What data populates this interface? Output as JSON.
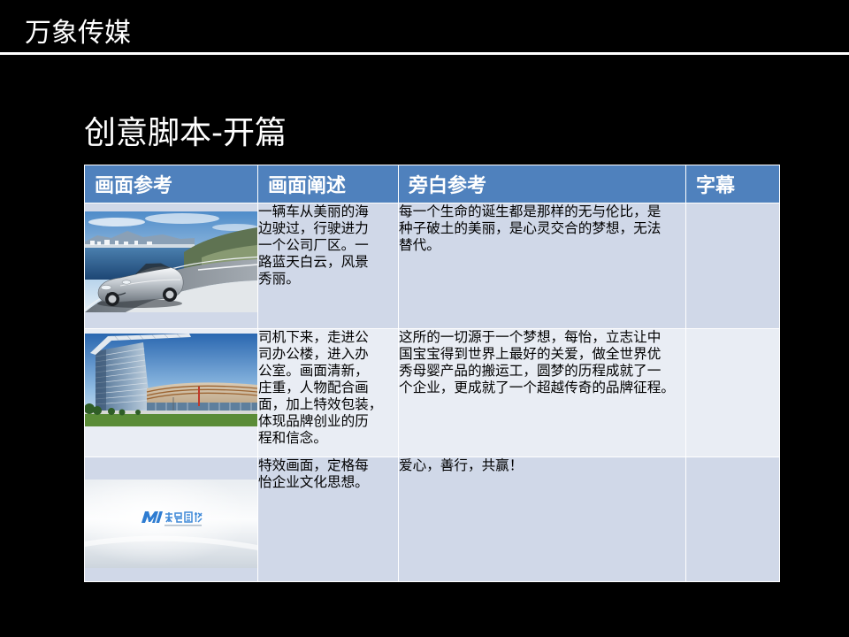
{
  "header": {
    "brand": "万象传媒"
  },
  "slide": {
    "title": "创意脚本-开篇"
  },
  "table": {
    "columns": [
      "画面参考",
      "画面阐述",
      "旁白参考",
      "字幕"
    ],
    "rows": [
      {
        "description": [
          "一辆车从美丽的海",
          "边驶过，行驶进力",
          "一个公司厂区。一",
          "路蓝天白云，风景",
          "秀丽。"
        ],
        "narration": [
          "每一个生命的诞生都是那样的无与伦比，是",
          "种子破土的美丽，是心灵交合的梦想，无法",
          "替代。"
        ]
      },
      {
        "description": [
          "司机下来，走进公",
          "司办公楼，进入办",
          "公室。画面清新，",
          "庄重，人物配合画",
          "面，加上特效包装，",
          "体现品牌创业的历",
          "程和信念。"
        ],
        "narration": [
          "这所的一切源于一个梦想，每怡，立志让中",
          "国宝宝得到世界上最好的关爱，做全世界优",
          "秀母婴产品的搬运工，圆梦的历程成就了一",
          "个企业，更成就了一个超越传奇的品牌征程。"
        ]
      },
      {
        "description": [
          "特效画面，定格每",
          "怡企业文化思想。"
        ],
        "narration": [
          "爱心，善行，共赢！"
        ]
      }
    ]
  },
  "colors": {
    "background": "#000000",
    "header_fill": "#4F81BD",
    "band_dark": "#D0D8E8",
    "band_light": "#E9EDF4",
    "text_light": "#FFFFFF",
    "text_dark": "#000000"
  }
}
